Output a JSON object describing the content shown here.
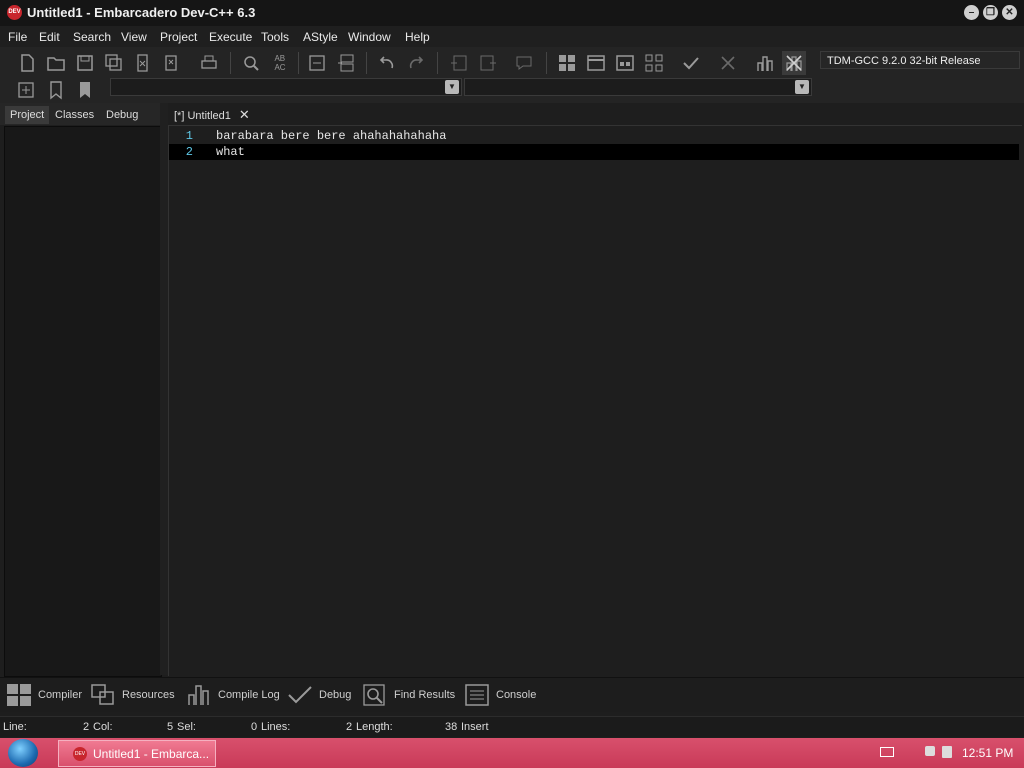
{
  "window": {
    "title": "Untitled1 - Embarcadero Dev-C++ 6.3",
    "icon_text": "DEV"
  },
  "menu": [
    "File",
    "Edit",
    "Search",
    "View",
    "Project",
    "Execute",
    "Tools",
    "AStyle",
    "Window",
    "Help"
  ],
  "toolbar": {
    "compiler": "TDM-GCC 9.2.0 32-bit Release"
  },
  "left_tabs": [
    "Project",
    "Classes",
    "Debug"
  ],
  "editor": {
    "tab_label": "[*] Untitled1",
    "lines": [
      {
        "number": "1",
        "text": "barabara bere bere ahahahahahaha"
      },
      {
        "number": "2",
        "text": "what"
      }
    ]
  },
  "bottom_tabs": [
    "Compiler",
    "Resources",
    "Compile Log",
    "Debug",
    "Find Results",
    "Console"
  ],
  "status": {
    "line_label": "Line:",
    "line_value": "2",
    "col_label": "Col:",
    "col_value": "5",
    "sel_label": "Sel:",
    "sel_value": "0",
    "lines_label": "Lines:",
    "lines_value": "2",
    "length_label": "Length:",
    "length_value": "38",
    "mode": "Insert"
  },
  "taskbar": {
    "task_label": "Untitled1 - Embarca...",
    "clock": "12:51 PM"
  },
  "colors": {
    "accent_line_number": "#5ec7e6",
    "taskbar": "#c93a58"
  }
}
